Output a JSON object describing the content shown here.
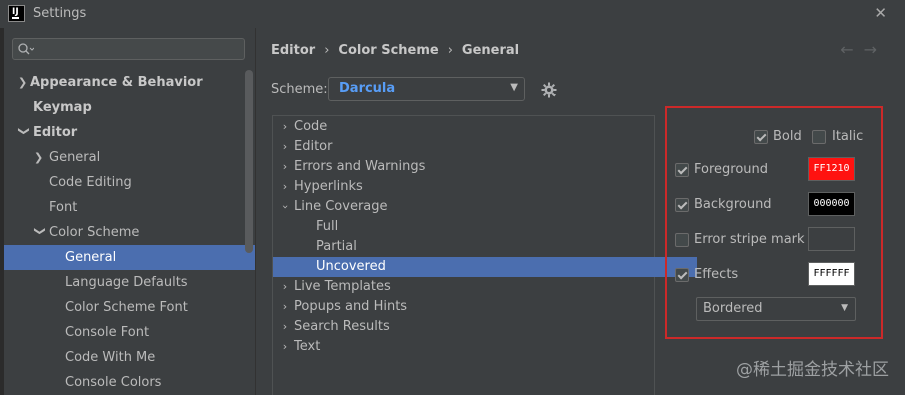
{
  "window": {
    "title": "Settings"
  },
  "search": {
    "placeholder": ""
  },
  "sidebar": {
    "items": [
      {
        "label": "Appearance & Behavior"
      },
      {
        "label": "Keymap"
      },
      {
        "label": "Editor"
      },
      {
        "label": "General"
      },
      {
        "label": "Code Editing"
      },
      {
        "label": "Font"
      },
      {
        "label": "Color Scheme"
      },
      {
        "label": "General"
      },
      {
        "label": "Language Defaults"
      },
      {
        "label": "Color Scheme Font"
      },
      {
        "label": "Console Font"
      },
      {
        "label": "Code With Me"
      },
      {
        "label": "Console Colors"
      }
    ]
  },
  "breadcrumb": {
    "part1": "Editor",
    "part2": "Color Scheme",
    "part3": "General",
    "separator": "›"
  },
  "scheme": {
    "label": "Scheme:",
    "value": "Darcula"
  },
  "color_tree": {
    "items": [
      {
        "label": "Code"
      },
      {
        "label": "Editor"
      },
      {
        "label": "Errors and Warnings"
      },
      {
        "label": "Hyperlinks"
      },
      {
        "label": "Line Coverage"
      },
      {
        "label": "Full"
      },
      {
        "label": "Partial"
      },
      {
        "label": "Uncovered"
      },
      {
        "label": "Live Templates"
      },
      {
        "label": "Popups and Hints"
      },
      {
        "label": "Search Results"
      },
      {
        "label": "Text"
      }
    ]
  },
  "props": {
    "bold": {
      "label": "Bold",
      "checked": true
    },
    "italic": {
      "label": "Italic",
      "checked": false
    },
    "foreground": {
      "label": "Foreground",
      "checked": true,
      "value": "FF1210",
      "color": "#ff1210"
    },
    "background": {
      "label": "Background",
      "checked": true,
      "value": "000000",
      "color": "#000000"
    },
    "error_stripe": {
      "label": "Error stripe mark",
      "checked": false,
      "value": ""
    },
    "effects": {
      "label": "Effects",
      "checked": true,
      "value": "FFFFFF",
      "color": "#ffffff"
    },
    "effect_type": {
      "value": "Bordered"
    }
  },
  "watermark": "@稀土掘金技术社区",
  "colors": {
    "selection": "#4b6eaf",
    "highlight_border": "#cc2929",
    "scheme_value": "#589df6"
  }
}
